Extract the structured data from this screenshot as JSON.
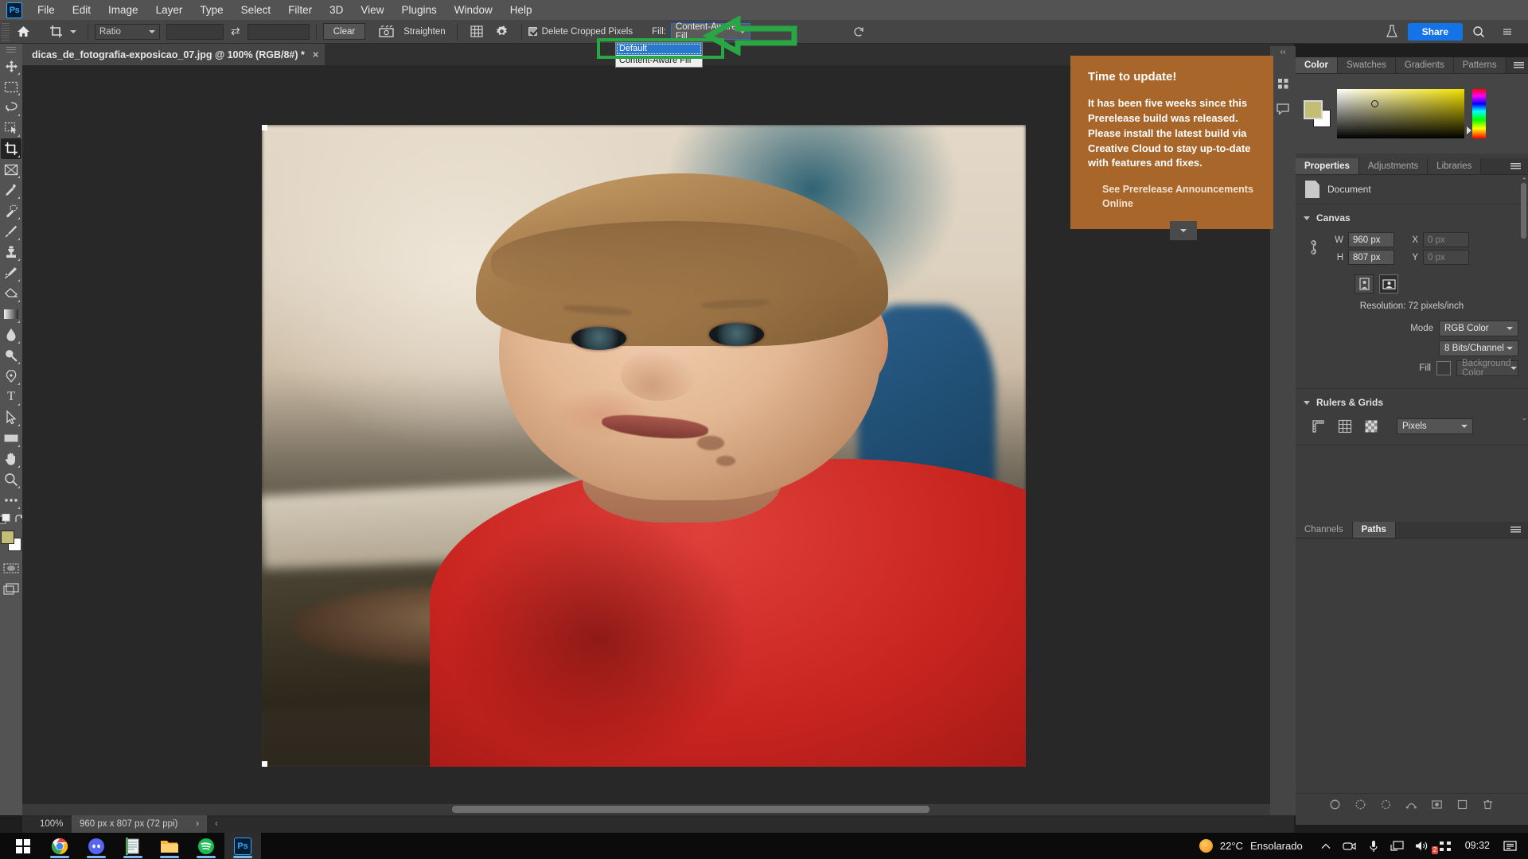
{
  "app": {
    "name": "Adobe Photoshop",
    "logo_text": "Ps",
    "menus": [
      "File",
      "Edit",
      "Image",
      "Layer",
      "Type",
      "Select",
      "Filter",
      "3D",
      "View",
      "Plugins",
      "Window",
      "Help"
    ]
  },
  "options_bar": {
    "home_icon": "home-icon",
    "tool_icon": "crop-tool-icon",
    "ratio_select": "Ratio",
    "width_value": "",
    "height_value": "",
    "swap_icon": "swap-arrows-icon",
    "clear_label": "Clear",
    "straighten_icon": "straighten-icon",
    "straighten_label": "Straighten",
    "overlay_icon": "grid-overlay-icon",
    "settings_icon": "gear-icon",
    "delete_cropped_label": "Delete Cropped Pixels",
    "delete_cropped_checked": true,
    "fill_label": "Fill:",
    "fill_value": "Content-Aware Fill",
    "reset_icon": "reset-icon",
    "workspace_icon": "workspace-icon",
    "share_label": "Share",
    "search_icon": "search-icon",
    "more_icon": "more-icon"
  },
  "fill_dropdown": {
    "options": [
      "Default",
      "Content-Aware Fill"
    ],
    "selected_index": 0,
    "highlight_color": "#2878d0"
  },
  "annotation": {
    "arrow_color": "#2aa745",
    "arrow_icon": "left-arrow-annotation",
    "box_icon": "highlight-box-annotation"
  },
  "document_tab": {
    "title": "dicas_de_fotografia-exposicao_07.jpg @ 100% (RGB/8#) *",
    "close_icon": "close-icon"
  },
  "toolbar": {
    "tools": [
      {
        "name": "move-tool",
        "glyph": "move"
      },
      {
        "name": "rectangular-marquee-tool",
        "glyph": "marquee"
      },
      {
        "name": "lasso-tool",
        "glyph": "lasso"
      },
      {
        "name": "object-selection-tool",
        "glyph": "objsel"
      },
      {
        "name": "crop-tool",
        "glyph": "crop",
        "active": true
      },
      {
        "name": "frame-tool",
        "glyph": "frame"
      },
      {
        "name": "eyedropper-tool",
        "glyph": "eyedropper"
      },
      {
        "name": "spot-healing-brush-tool",
        "glyph": "healing"
      },
      {
        "name": "brush-tool",
        "glyph": "brush"
      },
      {
        "name": "clone-stamp-tool",
        "glyph": "stamp"
      },
      {
        "name": "history-brush-tool",
        "glyph": "historybrush"
      },
      {
        "name": "eraser-tool",
        "glyph": "eraser"
      },
      {
        "name": "gradient-tool",
        "glyph": "gradient"
      },
      {
        "name": "blur-tool",
        "glyph": "blur"
      },
      {
        "name": "dodge-tool",
        "glyph": "dodge"
      },
      {
        "name": "pen-tool",
        "glyph": "pen"
      },
      {
        "name": "type-tool",
        "glyph": "type"
      },
      {
        "name": "path-selection-tool",
        "glyph": "pathsel"
      },
      {
        "name": "rectangle-tool",
        "glyph": "rect"
      },
      {
        "name": "hand-tool",
        "glyph": "hand"
      },
      {
        "name": "zoom-tool",
        "glyph": "zoom"
      },
      {
        "name": "edit-toolbar",
        "glyph": "dots"
      }
    ],
    "foreground_color": "#c3bd76",
    "background_color": "#ffffff",
    "quick_mask_icon": "quick-mask-icon",
    "screen_mode_icon": "screen-mode-icon"
  },
  "notification": {
    "title": "Time to update!",
    "body": "It has been five weeks since this Prerelease build was released. Please install the latest build via Creative Cloud to stay up-to-date with features and fixes.",
    "link": "See Prerelease Announcements Online",
    "background": "#a8662a",
    "collapse_icon": "chevron-down-icon"
  },
  "canvas": {
    "image_alt": "portrait-of-boy-in-red-shirt",
    "zoom": "100%",
    "dimensions": "960 px x 807 px (72 ppi)",
    "next_icon": "chevron-right-icon",
    "prev_icon": "chevron-left-icon"
  },
  "right_dock": {
    "collapse_icon": "double-chevron-icon",
    "icon_rail": [
      "libraries-icon",
      "comments-icon"
    ],
    "color_panel": {
      "tabs": [
        "Color",
        "Swatches",
        "Gradients",
        "Patterns"
      ],
      "active_tab": "Color",
      "menu_icon": "panel-menu-icon",
      "foreground": "#c3bd76",
      "background": "#ffffff"
    },
    "properties_panel": {
      "tabs": [
        "Properties",
        "Adjustments",
        "Libraries"
      ],
      "active_tab": "Properties",
      "menu_icon": "panel-menu-icon",
      "doc_icon": "document-icon",
      "doc_label": "Document",
      "canvas_section": {
        "title": "Canvas",
        "link_icon": "link-icon",
        "w_label": "W",
        "w_value": "960 px",
        "h_label": "H",
        "h_value": "807 px",
        "x_label": "X",
        "x_value": "0 px",
        "y_label": "Y",
        "y_value": "0 px",
        "portrait_icon": "portrait-orientation-icon",
        "landscape_icon": "landscape-orientation-icon",
        "orientation_selected": "landscape",
        "resolution": "Resolution: 72 pixels/inch",
        "mode_label": "Mode",
        "mode_value": "RGB Color",
        "depth_value": "8 Bits/Channel",
        "fill_label": "Fill",
        "fill_value": "Background Color"
      },
      "rulers_section": {
        "title": "Rulers & Grids",
        "ruler_icon": "ruler-icon",
        "grid_icon": "grid-icon",
        "transparency_icon": "transparency-icon",
        "units_value": "Pixels"
      }
    },
    "channels_panel": {
      "tabs": [
        "Channels",
        "Paths"
      ],
      "active_tab": "Paths",
      "menu_icon": "panel-menu-icon",
      "footer_icons": [
        "fill-path-icon",
        "stroke-path-icon",
        "load-selection-icon",
        "make-path-icon",
        "add-mask-icon",
        "new-path-icon",
        "delete-path-icon"
      ]
    }
  },
  "taskbar": {
    "start_icon": "windows-start-icon",
    "apps": [
      {
        "name": "chrome-taskbar-icon",
        "open": true
      },
      {
        "name": "discord-taskbar-icon",
        "open": true
      },
      {
        "name": "notepad-taskbar-icon",
        "open": true
      },
      {
        "name": "file-explorer-taskbar-icon",
        "open": true
      },
      {
        "name": "spotify-taskbar-icon",
        "open": true
      },
      {
        "name": "photoshop-taskbar-icon",
        "open": true,
        "focused": true
      }
    ],
    "weather_temp": "22°C",
    "weather_text": "Ensolarado",
    "tray": [
      "chevron-up-icon",
      "camera-icon",
      "microphone-icon",
      "display-icon",
      "volume-icon",
      "network-icon"
    ],
    "notification_badge": "2",
    "clock": "09:32",
    "action_center_icon": "notifications-icon"
  }
}
